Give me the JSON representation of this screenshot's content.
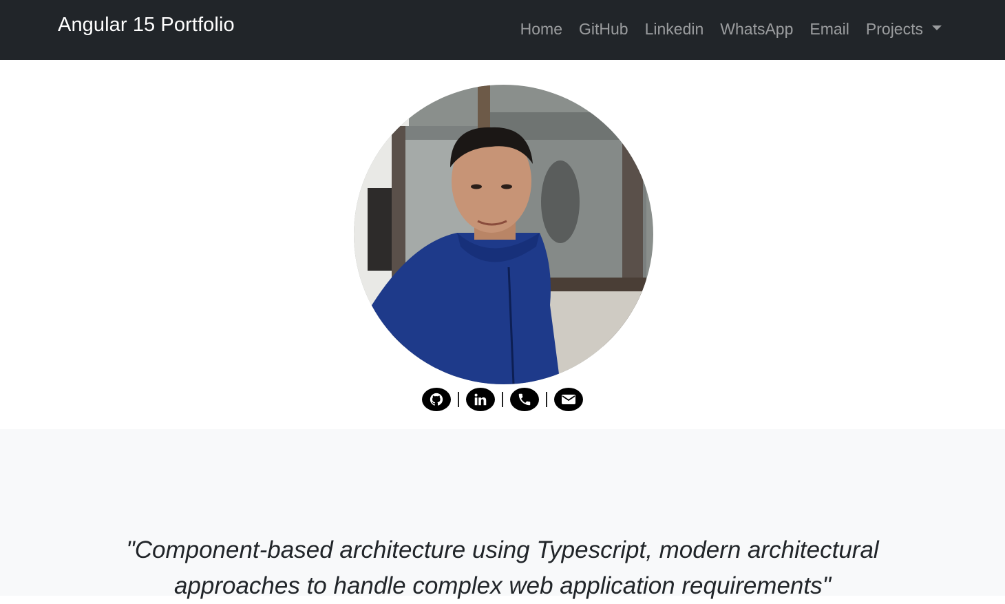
{
  "navbar": {
    "brand": "Angular 15 Portfolio",
    "links": [
      {
        "label": "Home"
      },
      {
        "label": "GitHub"
      },
      {
        "label": "Linkedin"
      },
      {
        "label": "WhatsApp"
      },
      {
        "label": "Email"
      }
    ],
    "dropdown": {
      "label": "Projects"
    }
  },
  "hero": {
    "social": [
      {
        "icon": "github-icon"
      },
      {
        "icon": "linkedin-icon"
      },
      {
        "icon": "phone-icon"
      },
      {
        "icon": "email-icon"
      }
    ]
  },
  "quote": {
    "text": "\"Component-based architecture using Typescript, modern architectural approaches to handle complex web application requirements\""
  },
  "colors": {
    "navbar_bg": "#212529",
    "nav_link": "rgba(255,255,255,0.55)",
    "quote_bg": "#f8f9fa",
    "icon_bg": "#000000"
  }
}
